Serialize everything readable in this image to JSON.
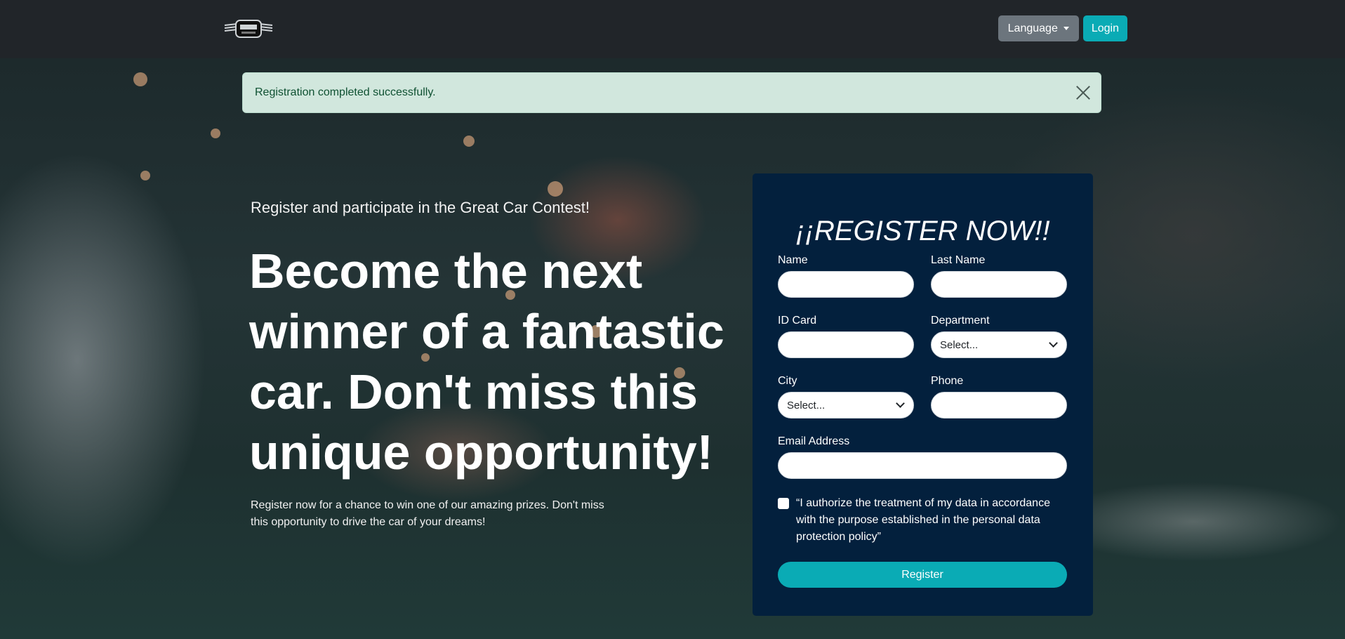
{
  "nav": {
    "logo_icon": "car-logo",
    "language_label": "Language",
    "login_label": "Login"
  },
  "alert": {
    "message": "Registration completed successfully.",
    "close_icon": "close-icon"
  },
  "hero": {
    "lead": "Register and participate in the Great Car Contest!",
    "headline": "Become the next winner of a fantastic car. Don't miss this unique opportunity!",
    "subtext": "Register now for a chance to win one of our amazing prizes. Don't miss this opportunity to drive the car of your dreams!"
  },
  "form": {
    "title": "¡¡REGISTER NOW!!",
    "name_label": "Name",
    "last_name_label": "Last Name",
    "id_card_label": "ID Card",
    "department_label": "Department",
    "department_value": "Select...",
    "city_label": "City",
    "city_value": "Select...",
    "phone_label": "Phone",
    "email_label": "Email Address",
    "consent_text": "“I authorize the treatment of my data in accordance with the purpose established in the personal data protection policy”",
    "register_label": "Register"
  },
  "colors": {
    "navbar": "#212529",
    "accent": "#0aabb5",
    "card": "#03203d",
    "alert_bg": "#d1e7dd"
  }
}
